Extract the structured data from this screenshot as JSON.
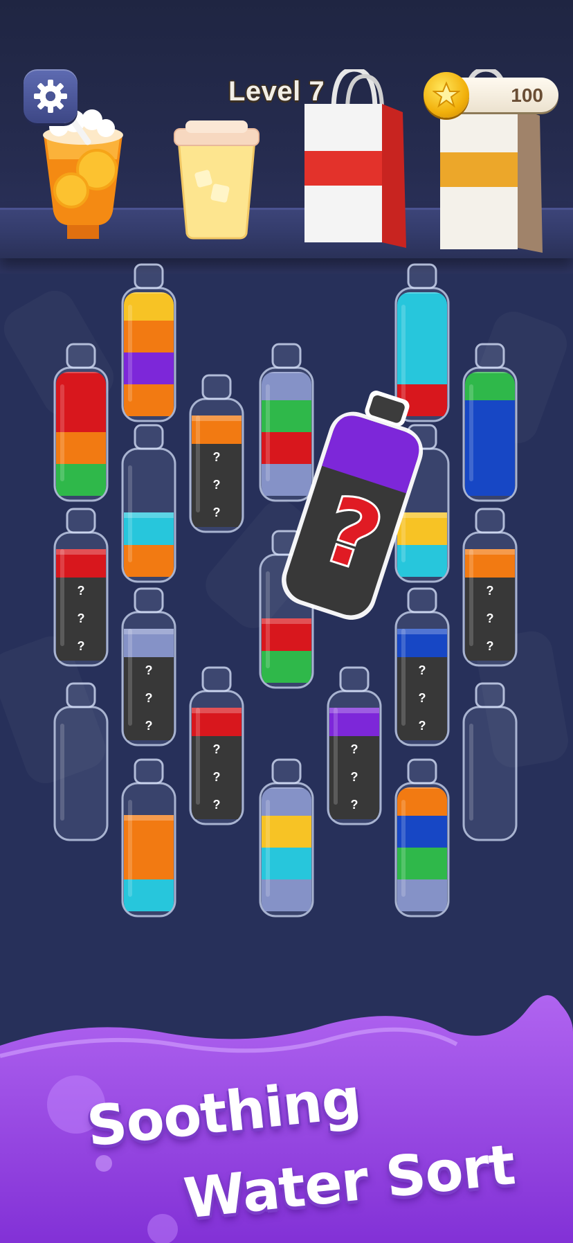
{
  "header": {
    "level_label": "Level 7",
    "coins": "100"
  },
  "colors": {
    "yellow": "#f7c325",
    "orange": "#f27a12",
    "purple": "#7d27d9",
    "red": "#d8171d",
    "green": "#2fb84a",
    "cyan": "#27c6dc",
    "blue": "#1747c5",
    "grayblue": "#8592c7",
    "hidden": "#383838"
  },
  "shelf_items": [
    {
      "name": "orange-juice-cup-icon"
    },
    {
      "name": "lemonade-cup-icon"
    },
    {
      "name": "red-shopping-bag-icon"
    },
    {
      "name": "orange-shopping-bag-icon"
    }
  ],
  "bottles": [
    {
      "id": "b1",
      "layers": [
        "green",
        "orange",
        "red",
        "red"
      ],
      "hidden": 0
    },
    {
      "id": "b2",
      "layers": [
        "orange",
        "purple",
        "orange",
        "yellow"
      ],
      "hidden": 0
    },
    {
      "id": "b3",
      "layers": [
        "orange"
      ],
      "hidden": 3
    },
    {
      "id": "b4",
      "layers": [
        "grayblue",
        "red",
        "green",
        "grayblue"
      ],
      "hidden": 0
    },
    {
      "id": "b5",
      "layers": [
        "red",
        "cyan",
        "cyan",
        "cyan"
      ],
      "hidden": 0
    },
    {
      "id": "b6",
      "layers": [
        "blue",
        "blue",
        "blue",
        "green"
      ],
      "hidden": 0
    },
    {
      "id": "b7",
      "layers": [
        "orange",
        "cyan"
      ],
      "hidden": 0
    },
    {
      "id": "b8",
      "layers": [
        "cyan",
        "yellow"
      ],
      "hidden": 0
    },
    {
      "id": "b9",
      "layers": [
        "red"
      ],
      "hidden": 3
    },
    {
      "id": "b10",
      "layers": [
        "green",
        "red"
      ],
      "hidden": 0
    },
    {
      "id": "b11",
      "layers": [
        "orange"
      ],
      "hidden": 3
    },
    {
      "id": "b12",
      "layers": [
        "grayblue"
      ],
      "hidden": 3
    },
    {
      "id": "b13",
      "layers": [
        "blue"
      ],
      "hidden": 3
    },
    {
      "id": "b14",
      "layers": [],
      "hidden": 0
    },
    {
      "id": "b15",
      "layers": [
        "red"
      ],
      "hidden": 3
    },
    {
      "id": "b16",
      "layers": [
        "purple"
      ],
      "hidden": 3
    },
    {
      "id": "b17",
      "layers": [],
      "hidden": 0
    },
    {
      "id": "b18",
      "layers": [
        "cyan",
        "orange",
        "orange"
      ],
      "hidden": 0
    },
    {
      "id": "b19",
      "layers": [
        "grayblue",
        "cyan",
        "yellow",
        "grayblue"
      ],
      "hidden": 0
    },
    {
      "id": "b20",
      "layers": [
        "grayblue",
        "green",
        "blue",
        "orange"
      ],
      "hidden": 0
    }
  ],
  "selected_bottle": {
    "layers": [
      "purple"
    ],
    "hidden": 3,
    "mark": "?"
  },
  "hidden_mark": "?",
  "banner": {
    "line1": "Soothing",
    "line2": "Water Sort"
  }
}
